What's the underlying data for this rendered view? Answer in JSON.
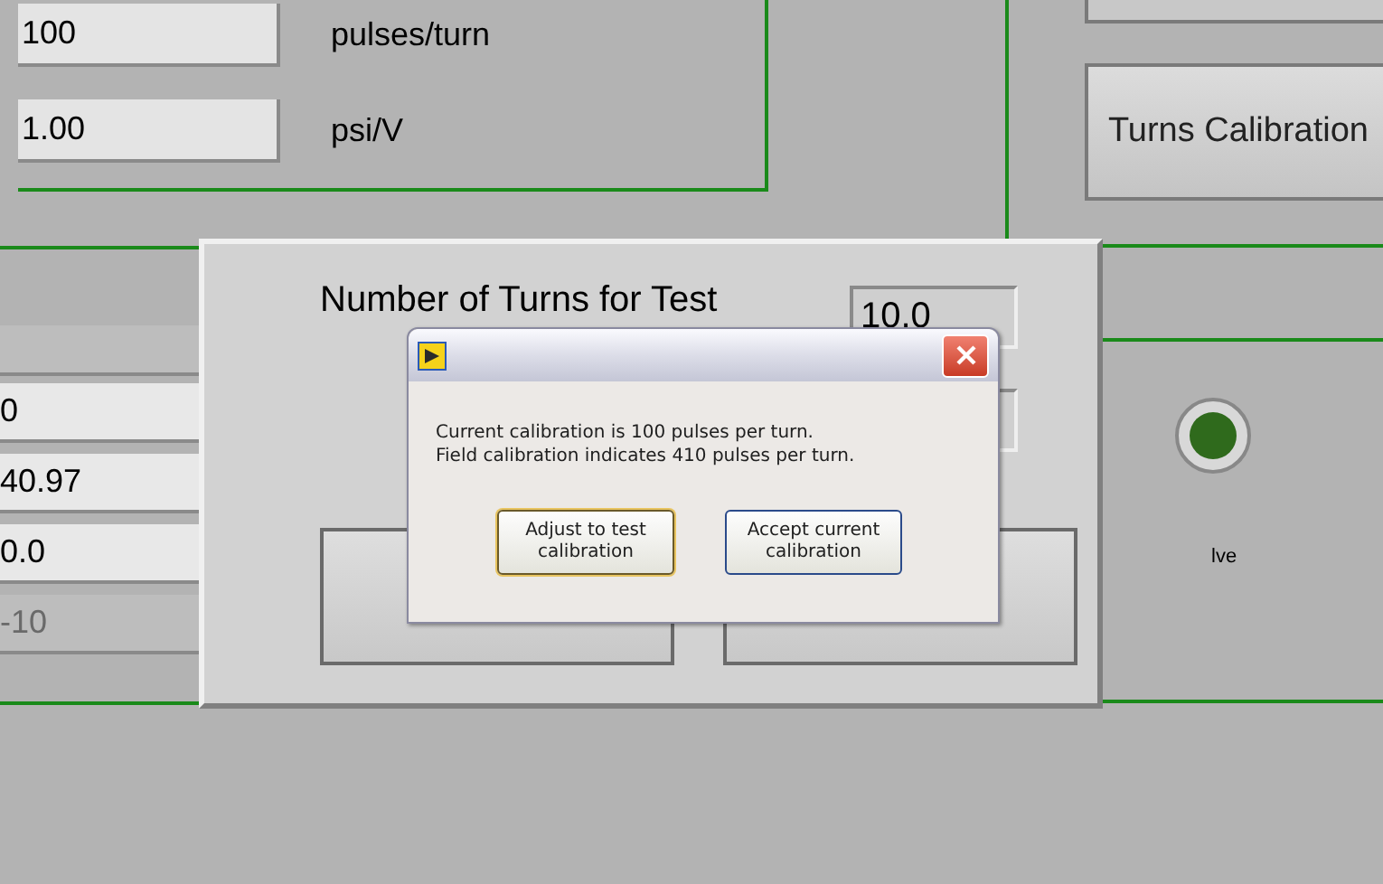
{
  "top_panel": {
    "fields": [
      {
        "value": "100",
        "unit": "pulses/turn"
      },
      {
        "value": "1.00",
        "unit": "psi/V"
      }
    ]
  },
  "turns_calibration_button": {
    "label": "Turns Calibration"
  },
  "left_panel": {
    "fields": [
      {
        "value": "0",
        "disabled": false
      },
      {
        "value": "40.97",
        "disabled": false
      },
      {
        "value": "0.0",
        "disabled": false
      },
      {
        "value": "-10",
        "disabled": true
      }
    ]
  },
  "test_panel": {
    "turns_label": "Number of Turns for Test",
    "turns_value": "10.0"
  },
  "valve": {
    "label": "lve",
    "on": true
  },
  "dialog": {
    "message_lines": [
      "Current calibration is 100 pulses per turn.",
      "Field calibration indicates 410 pulses per turn."
    ],
    "buttons": [
      {
        "label": "Adjust to test calibration",
        "focused": true
      },
      {
        "label": "Accept current calibration",
        "focused": false
      }
    ]
  }
}
